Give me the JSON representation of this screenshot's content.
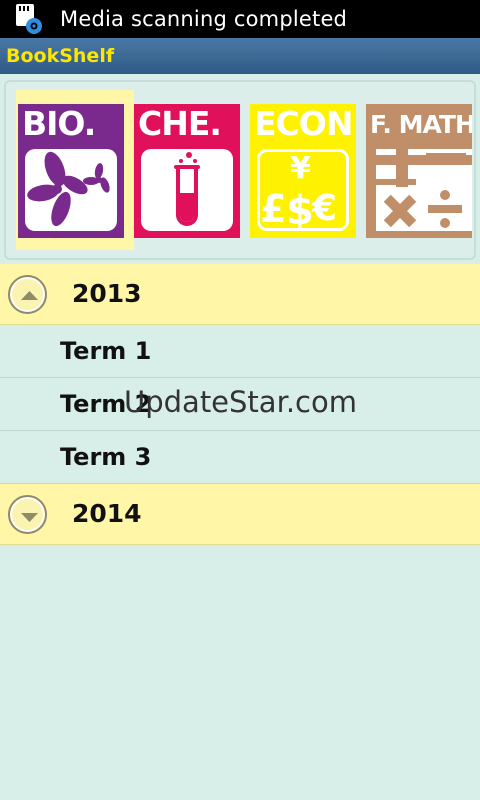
{
  "status_bar": {
    "notification_icon": "sd-card-gear-icon",
    "text": "Media scanning completed"
  },
  "app_bar": {
    "title": "BookShelf"
  },
  "shelf": {
    "books": [
      {
        "label": "BIO.",
        "color": "#7a2a8c",
        "icon": "flower-icon",
        "selected": true
      },
      {
        "label": "CHE.",
        "color": "#e0105a",
        "icon": "test-tube-icon",
        "selected": false
      },
      {
        "label": "ECON",
        "color": "#fff200",
        "icon": "currency-icon",
        "selected": false
      },
      {
        "label": "F. MATH",
        "color": "#c08e68",
        "icon": "math-operators-icon",
        "selected": false
      }
    ]
  },
  "groups": [
    {
      "label": "2013",
      "expanded": true,
      "children": [
        "Term 1",
        "Term 2",
        "Term 3"
      ]
    },
    {
      "label": "2014",
      "expanded": false,
      "children": []
    }
  ],
  "watermark": "UpdateStar.com",
  "colors": {
    "app_bar": "#3b6893",
    "title": "#ffe600",
    "group_bg": "#fff6a8",
    "list_bg": "#d8eee8"
  }
}
